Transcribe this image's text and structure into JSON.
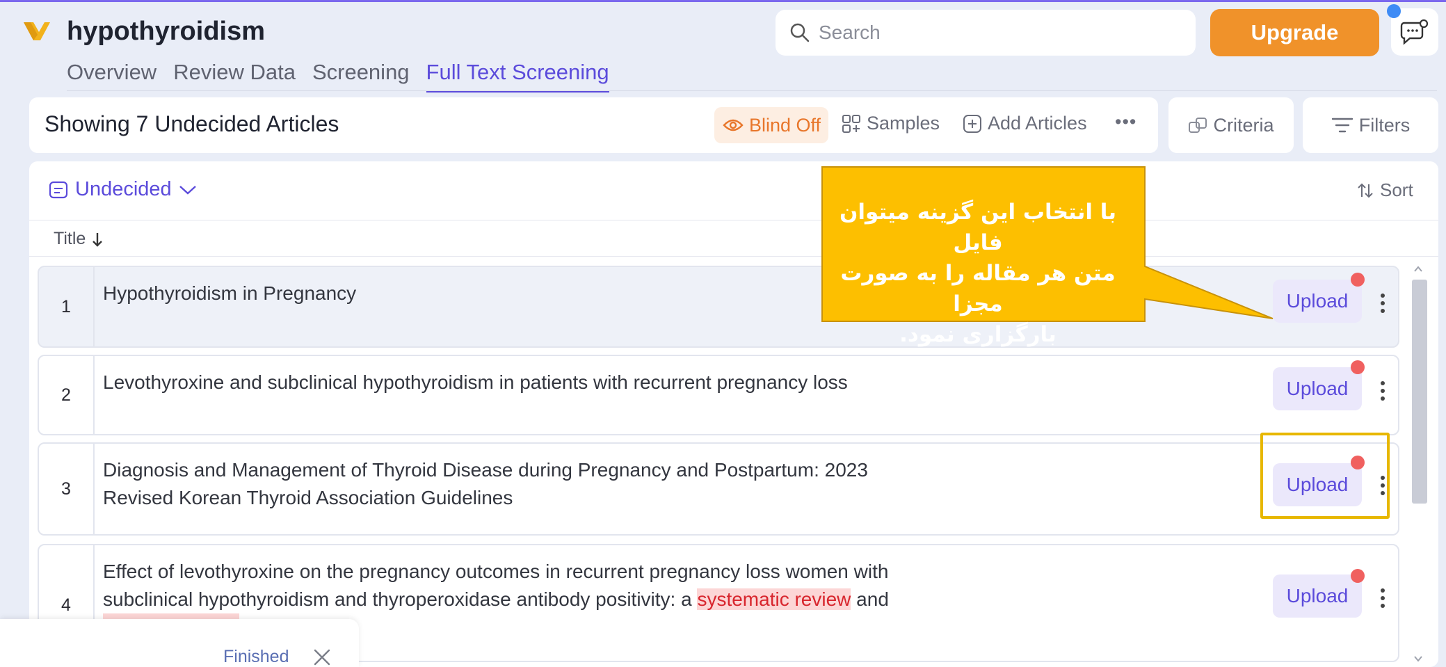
{
  "app": {
    "project_title": "hypothyroidism"
  },
  "tabs": [
    {
      "label": "Overview"
    },
    {
      "label": "Review Data"
    },
    {
      "label": "Screening"
    },
    {
      "label": "Full Text Screening",
      "active": true
    }
  ],
  "search": {
    "placeholder": "Search",
    "icon": "search-icon"
  },
  "header": {
    "upgrade_label": "Upgrade",
    "feedback_icon": "chat-feedback-icon"
  },
  "toolbar": {
    "showing_text": "Showing 7 Undecided Articles",
    "blind_label": "Blind Off",
    "samples_label": "Samples",
    "add_articles_label": "Add Articles",
    "more_label": "•••",
    "criteria_label": "Criteria",
    "filters_label": "Filters"
  },
  "list": {
    "filter_label": "Undecided",
    "sort_label": "Sort",
    "column_title": "Title"
  },
  "articles": [
    {
      "num": "1",
      "title": "Hypothyroidism in Pregnancy",
      "action": "Upload"
    },
    {
      "num": "2",
      "title": "Levothyroxine and subclinical hypothyroidism in patients with recurrent pregnancy loss",
      "action": "Upload"
    },
    {
      "num": "3",
      "title_line1": "Diagnosis and Management of Thyroid Disease during Pregnancy and Postpartum: 2023",
      "title_line2": "Revised Korean Thyroid Association Guidelines",
      "action": "Upload"
    },
    {
      "num": "4",
      "title_line1": "Effect of levothyroxine on the pregnancy outcomes in recurrent pregnancy loss women with",
      "title_line2_a": "subclinical hypothyroidism and thyroperoxidase antibody positivity: a ",
      "title_line2_hl": "systematic review",
      "title_line2_b": " and",
      "action": "Upload"
    }
  ],
  "callout": {
    "line1": "با انتخاب این گزینه میتوان فایل",
    "line2": "متن هر مقاله را به صورت مجزا",
    "line3": "بارگزاری نمود.",
    "color": "#fdbf00"
  },
  "toast": {
    "label": "Finished"
  },
  "colors": {
    "accent": "#5b4bdb",
    "upgrade": "#f0922a",
    "blind": "#e8762a",
    "highlight_border": "#e7b700"
  }
}
